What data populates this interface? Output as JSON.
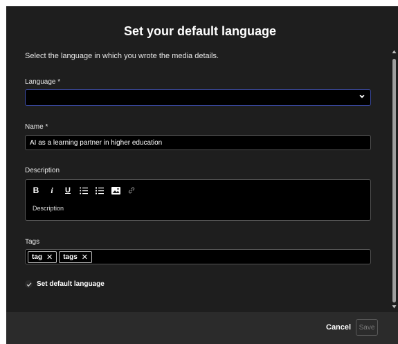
{
  "dialog": {
    "title": "Set your default language",
    "subtitle": "Select the language in which you wrote the media details."
  },
  "language": {
    "label": "Language *",
    "value": ""
  },
  "name": {
    "label": "Name *",
    "value": "AI as a learning partner in higher education"
  },
  "description": {
    "label": "Description",
    "placeholder": "Description",
    "toolbar": [
      "bold-icon",
      "italic-icon",
      "underline-icon",
      "bulleted-list-icon",
      "numbered-list-icon",
      "image-icon",
      "link-icon"
    ]
  },
  "tags": {
    "label": "Tags",
    "items": [
      "tag",
      "tags"
    ]
  },
  "default_checkbox": {
    "label": "Set default language",
    "checked": true
  },
  "footer": {
    "cancel_label": "Cancel",
    "save_label": "Save"
  },
  "colors": {
    "modal_bg": "#1e1e1e",
    "footer_bg": "#2b2b2b",
    "field_bg": "#000000",
    "focus_border": "#3b4aa0"
  }
}
